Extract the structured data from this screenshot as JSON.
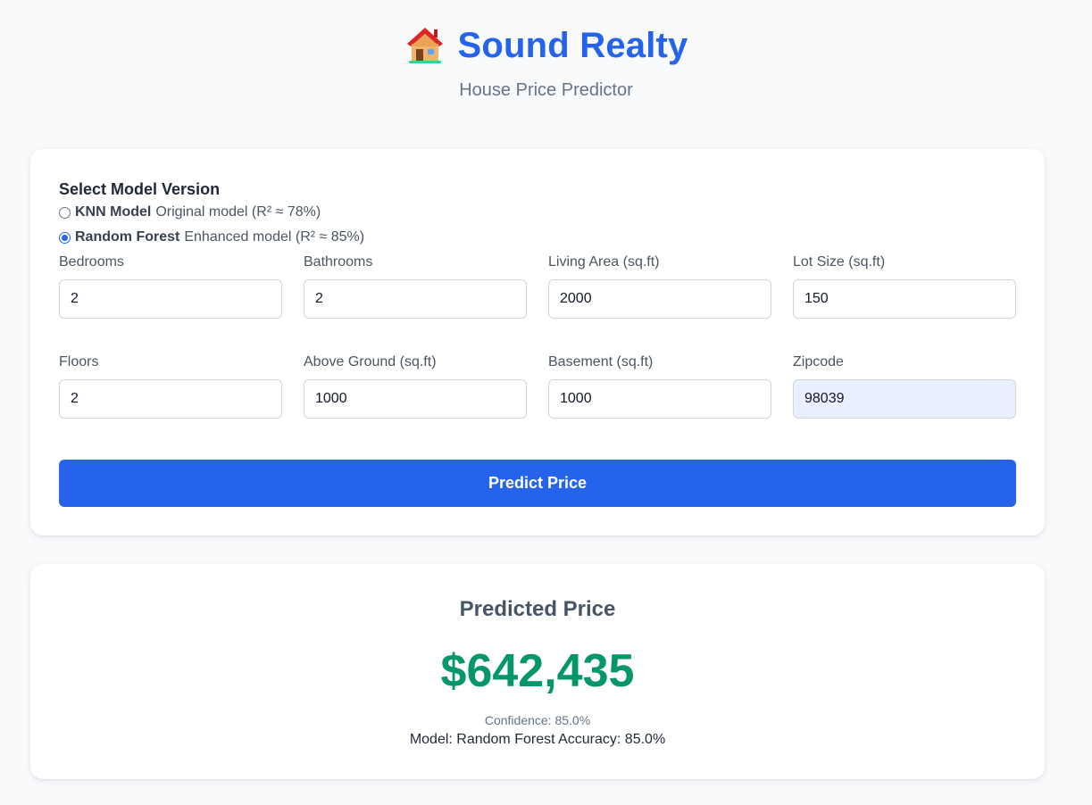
{
  "header": {
    "icon": "house-icon",
    "title": "Sound Realty",
    "subtitle": "House Price Predictor"
  },
  "model_select": {
    "heading": "Select Model Version",
    "options": [
      {
        "name": "KNN Model",
        "description": "Original model (R² ≈ 78%)",
        "selected": false
      },
      {
        "name": "Random Forest",
        "description": "Enhanced model (R² ≈ 85%)",
        "selected": true
      }
    ]
  },
  "fields": [
    {
      "label": "Bedrooms",
      "value": "2"
    },
    {
      "label": "Bathrooms",
      "value": "2"
    },
    {
      "label": "Living Area (sq.ft)",
      "value": "2000"
    },
    {
      "label": "Lot Size (sq.ft)",
      "value": "150"
    },
    {
      "label": "Floors",
      "value": "2"
    },
    {
      "label": "Above Ground (sq.ft)",
      "value": "1000"
    },
    {
      "label": "Basement (sq.ft)",
      "value": "1000"
    },
    {
      "label": "Zipcode",
      "value": "98039"
    }
  ],
  "predict_button": {
    "label": "Predict Price"
  },
  "result": {
    "title": "Predicted Price",
    "price": "$642,435",
    "confidence": "Confidence: 85.0%",
    "model_info": "Model: Random Forest Accuracy: 85.0%"
  },
  "colors": {
    "accent": "#2563eb",
    "price": "#059669",
    "background": "#f8fafc",
    "autofill": "#e8f0fe"
  }
}
